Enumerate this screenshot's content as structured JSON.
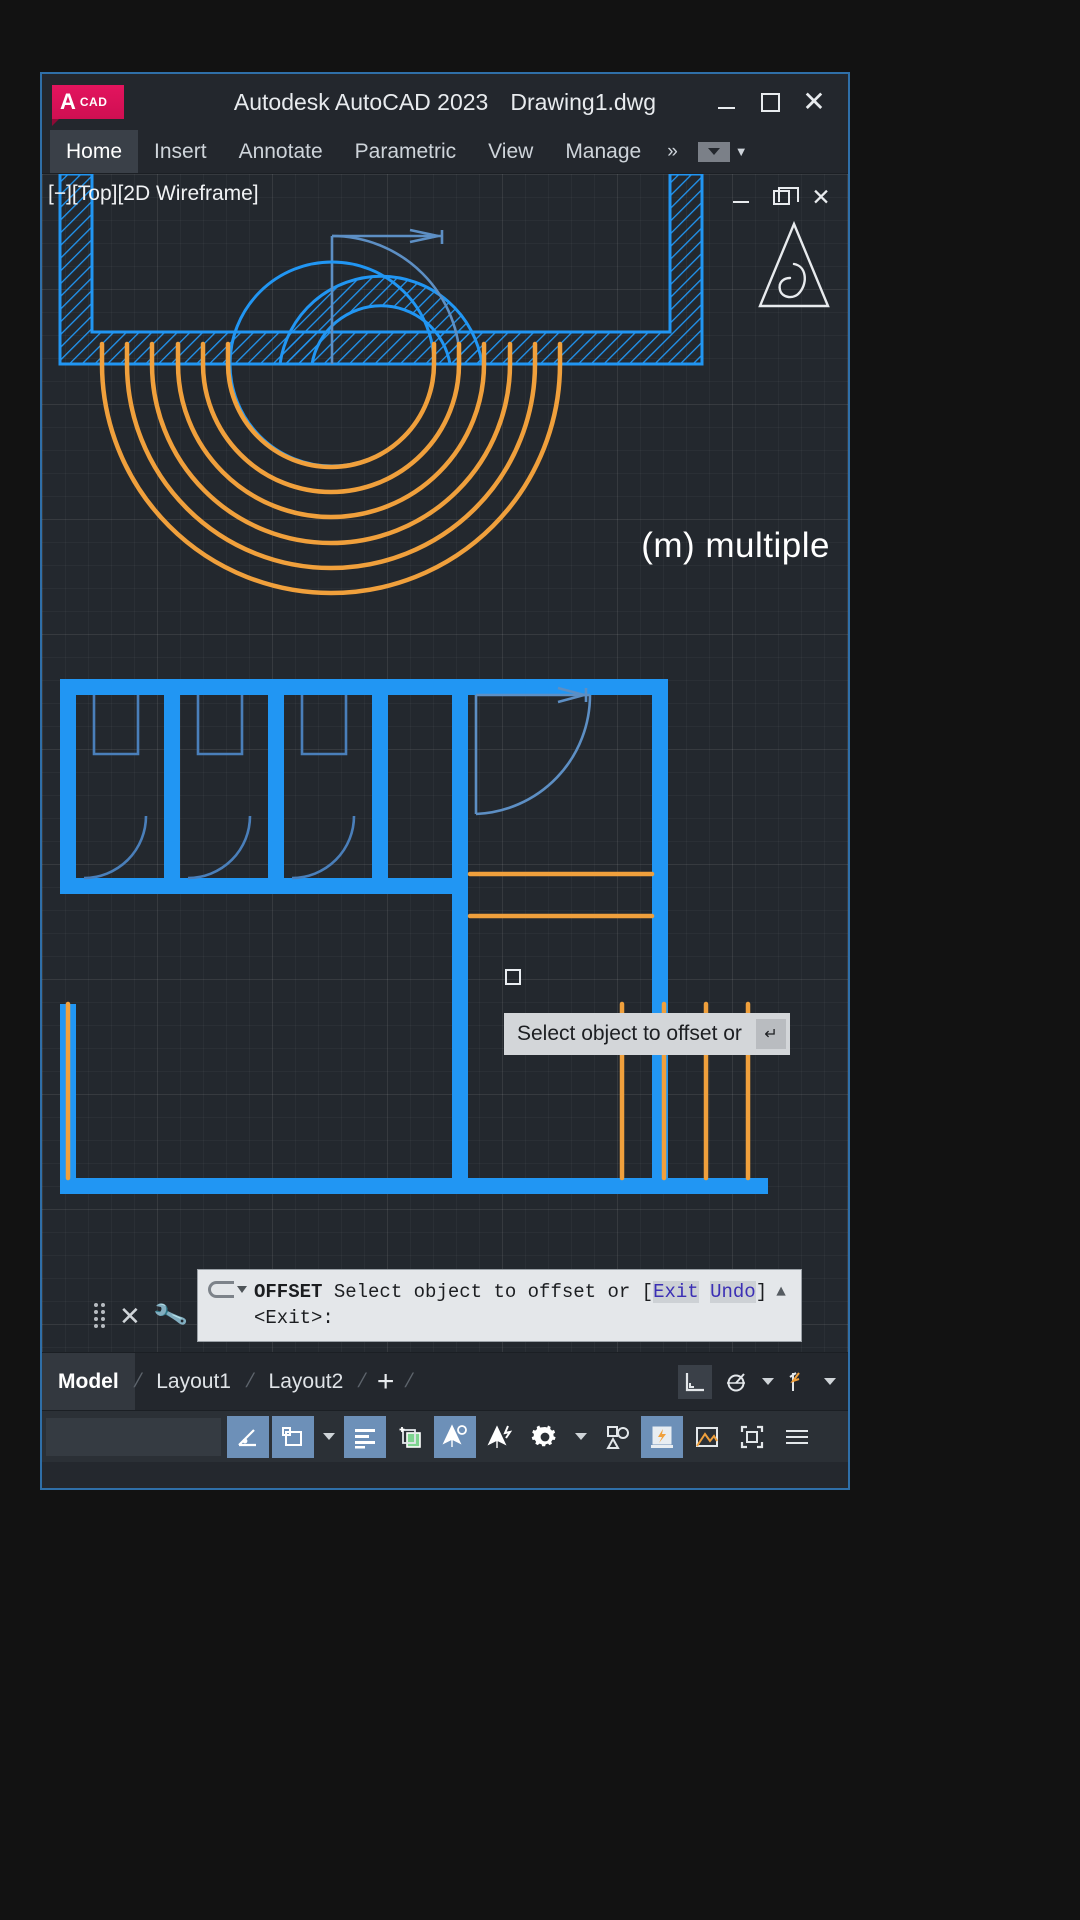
{
  "window": {
    "logo_a": "A",
    "logo_cad": "CAD",
    "app_title": "Autodesk AutoCAD 2023",
    "document_name": "Drawing1.dwg",
    "minimize_label": "Minimize",
    "maximize_label": "Maximize",
    "close_label": "Close"
  },
  "ribbon": {
    "tabs": [
      {
        "label": "Home",
        "active": true
      },
      {
        "label": "Insert",
        "active": false
      },
      {
        "label": "Annotate",
        "active": false
      },
      {
        "label": "Parametric",
        "active": false
      },
      {
        "label": "View",
        "active": false
      },
      {
        "label": "Manage",
        "active": false
      }
    ],
    "overflow": "»",
    "dropdown_caret": "▼"
  },
  "viewport": {
    "label": "[−][Top][2D Wireframe]",
    "minimize": "—",
    "restore": "❐",
    "close": "✕",
    "annotation": "(m) multiple",
    "cube_label": "viewcube"
  },
  "cursor": {
    "tooltip": "Select object to offset or",
    "tooltip_return": "↵"
  },
  "command": {
    "prompt_icon": "command-history",
    "command_name": "OFFSET",
    "prompt_text": " Select object to offset or [",
    "keyword_exit": "Exit",
    "keyword_undo": "Undo",
    "suffix": "] <Exit>:",
    "scroll_caret": "▲",
    "close_label": "✕",
    "customize_label": "customize"
  },
  "layout_tabs": {
    "tabs": [
      {
        "label": "Model",
        "active": true
      },
      {
        "label": "Layout1",
        "active": false
      },
      {
        "label": "Layout2",
        "active": false
      }
    ],
    "add_label": "+",
    "separator": "/",
    "right_tools": [
      {
        "name": "model-space-icon"
      },
      {
        "name": "annotation-scale-icon"
      },
      {
        "name": "annotation-visibility-icon"
      }
    ]
  },
  "status_bar": {
    "buttons": [
      {
        "name": "ortho-polar-icon",
        "on": true
      },
      {
        "name": "object-snap-icon",
        "on": true
      },
      {
        "name": "object-snap-dropdown",
        "on": false
      },
      {
        "name": "isolate-objects-icon",
        "on": true
      },
      {
        "name": "layer-new-icon",
        "on": false
      },
      {
        "name": "annotation-monitor-icon",
        "on": true
      },
      {
        "name": "annotation-scale-add-icon",
        "on": false
      },
      {
        "name": "settings-gear-icon",
        "on": false
      },
      {
        "name": "settings-dropdown",
        "on": false
      },
      {
        "name": "selection-cycling-icon",
        "on": false
      },
      {
        "name": "quick-properties-icon",
        "on": true
      },
      {
        "name": "isolate-display-icon",
        "on": false
      },
      {
        "name": "clean-screen-icon",
        "on": false
      },
      {
        "name": "customization-menu-icon",
        "on": false
      }
    ]
  },
  "colors": {
    "wall_blue": "#2196f3",
    "offset_orange": "#f0a03c",
    "door_swing": "#4a7fba",
    "canvas_bg": "#23282e",
    "chrome_bg": "#23272d",
    "accent_red": "#e3145e",
    "command_bg": "#e4e7ea",
    "keyword_purple": "#3b2fb5",
    "status_on": "#6d90b8"
  }
}
